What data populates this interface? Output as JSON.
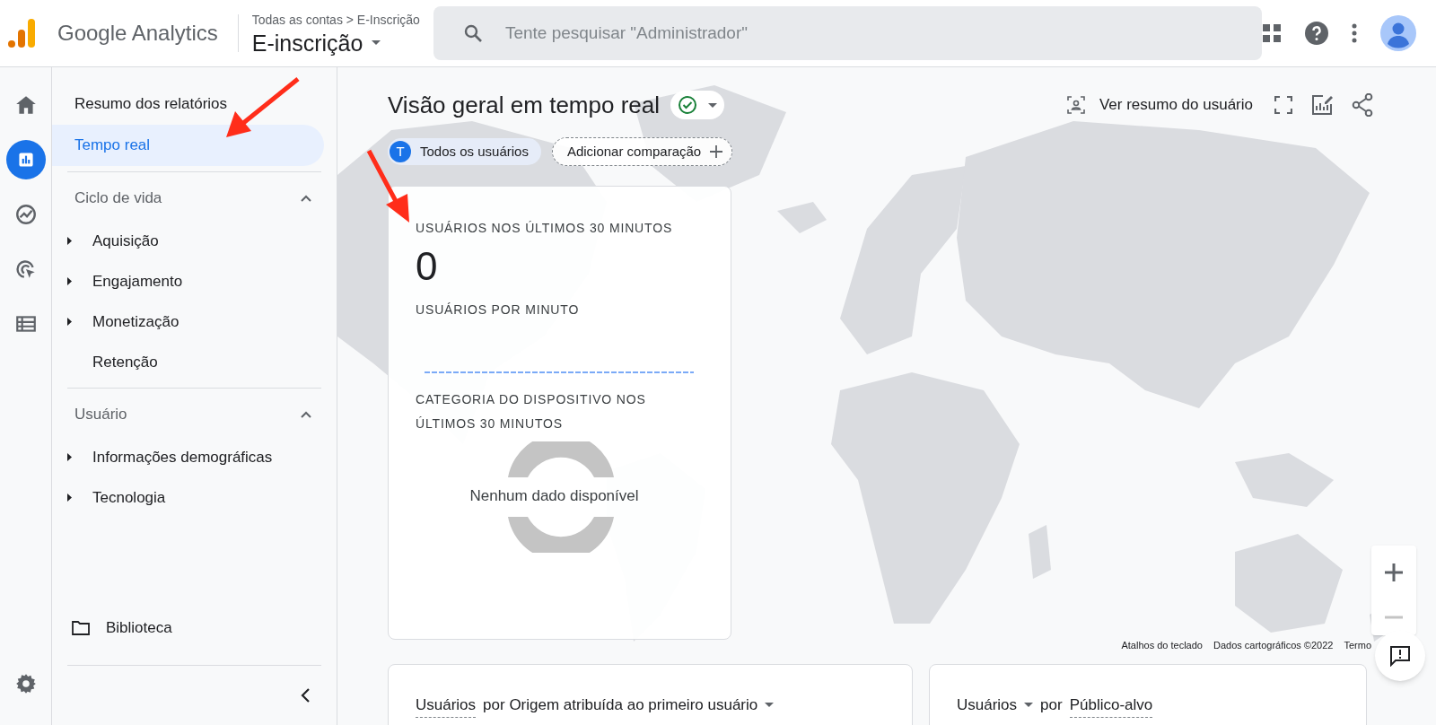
{
  "header": {
    "product": "Google Analytics",
    "breadcrumb": "Todas as contas > E-Inscrição",
    "property": "E-inscrição",
    "search": {
      "placeholder": "Tente pesquisar \"Administrador\""
    }
  },
  "rail": [
    {
      "kind": "home",
      "selected": false
    },
    {
      "kind": "reports",
      "selected": true
    },
    {
      "kind": "explore",
      "selected": false
    },
    {
      "kind": "advertising",
      "selected": false
    },
    {
      "kind": "configure",
      "selected": false
    }
  ],
  "sidebar": {
    "items": [
      {
        "label": "Resumo dos relatórios",
        "selected": false
      },
      {
        "label": "Tempo real",
        "selected": true
      }
    ],
    "sections": [
      {
        "title": "Ciclo de vida",
        "expanded": true,
        "items": [
          {
            "label": "Aquisição",
            "expandable": true
          },
          {
            "label": "Engajamento",
            "expandable": true
          },
          {
            "label": "Monetização",
            "expandable": true
          },
          {
            "label": "Retenção",
            "expandable": false
          }
        ]
      },
      {
        "title": "Usuário",
        "expanded": true,
        "items": [
          {
            "label": "Informações demográficas",
            "expandable": true
          },
          {
            "label": "Tecnologia",
            "expandable": true
          }
        ]
      }
    ],
    "library": "Biblioteca"
  },
  "report": {
    "title": "Visão geral em tempo real",
    "toolbar": {
      "summary": "Ver resumo do usuário"
    },
    "chips": [
      {
        "kind": "segment",
        "badge": "T",
        "label": "Todos os usuários"
      },
      {
        "kind": "add",
        "label": "Adicionar comparação"
      }
    ],
    "card": {
      "users_heading": "USUÁRIOS NOS ÚLTIMOS 30 MINUTOS",
      "users": "0",
      "per_minute_heading": "USUÁRIOS POR MINUTO",
      "device_heading": "CATEGORIA DO DISPOSITIVO NOS ÚLTIMOS 30 MINUTOS",
      "empty": "Nenhum dado disponível"
    },
    "map_attribution": [
      "Atalhos do teclado",
      "Dados cartográficos ©2022",
      "Termo"
    ],
    "bottom_cards": [
      {
        "parts": [
          {
            "text": "Usuários",
            "dotted": true,
            "dropdown": false
          },
          {
            "text": "por Origem atribuída ao primeiro usuário",
            "dotted": false,
            "dropdown": true
          }
        ]
      },
      {
        "parts": [
          {
            "text": "Usuários",
            "dotted": false,
            "dropdown": true
          },
          {
            "text": "por",
            "dotted": false,
            "dropdown": false
          },
          {
            "text": "Público-alvo",
            "dotted": true,
            "dropdown": false
          }
        ]
      }
    ]
  }
}
